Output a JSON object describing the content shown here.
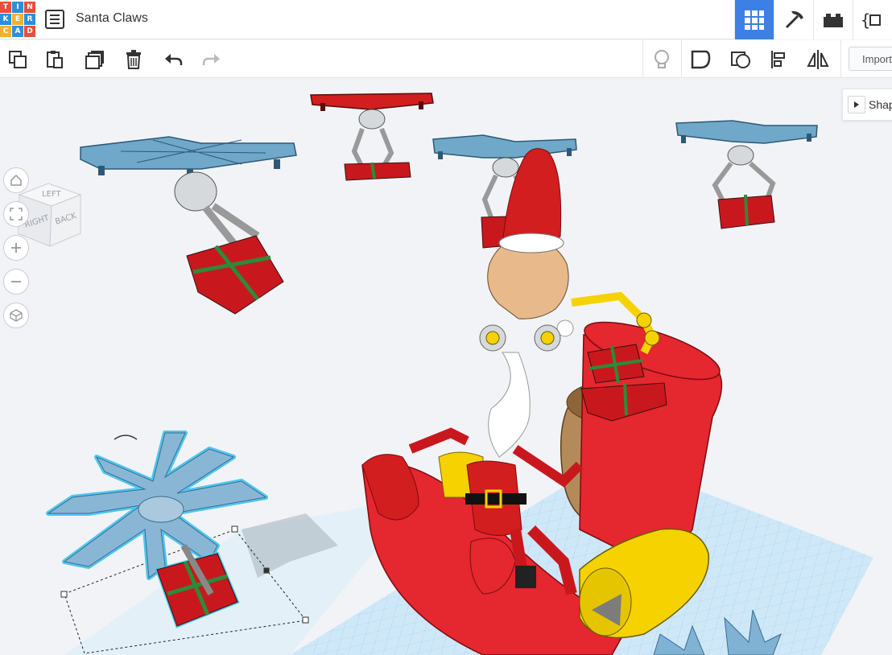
{
  "app": {
    "logo_letters": [
      "T",
      "I",
      "N",
      "K",
      "E",
      "R",
      "C",
      "A",
      "D"
    ],
    "logo_colors": [
      "#e94e3b",
      "#2c8fde",
      "#e94e3b",
      "#2c8fde",
      "#f6b12d",
      "#2c8fde",
      "#f6b12d",
      "#2c8fde",
      "#e94e3b"
    ],
    "title": "Santa Claws"
  },
  "view_buttons": [
    {
      "icon": "grid-3d-view-icon",
      "active": true
    },
    {
      "icon": "pickaxe-icon",
      "active": false
    },
    {
      "icon": "bricks-icon",
      "active": false
    },
    {
      "icon": "codeblocks-icon",
      "active": false
    }
  ],
  "toolbar": {
    "tools_left": [
      "copy-icon",
      "paste-icon",
      "duplicate-icon",
      "delete-icon",
      "undo-icon",
      "redo-icon"
    ],
    "tools_right": [
      "lightbulb-icon",
      "solid-shape-icon",
      "hole-shape-icon",
      "align-icon",
      "mirror-icon"
    ],
    "import_label": "Import"
  },
  "shapes_panel": {
    "label": "Shapes"
  },
  "view_cube": {
    "face_front": "BACK",
    "face_side": "RIGHT",
    "face_top": "LEFT"
  },
  "nav_controls": [
    "home-icon",
    "fit-view-icon",
    "zoom-in-icon",
    "zoom-out-icon",
    "orthographic-icon"
  ],
  "colors": {
    "accent": "#3c80e6",
    "selection_outline": "#4fc6f0",
    "drone": "#6fa8c9",
    "gift": "#d21e1e",
    "ribbon": "#2d8a3a",
    "sleigh": "#e5272f",
    "gold": "#f5d200",
    "sack": "#b58a5a",
    "grid": "#b7dcf3"
  }
}
